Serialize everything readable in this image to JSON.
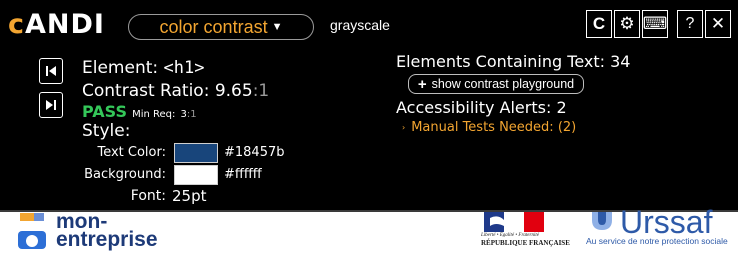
{
  "toolbar": {
    "logo_first": "c",
    "logo_rest": "ANDI",
    "module_label": "color contrast",
    "grayscale_label": "grayscale",
    "controls": [
      {
        "name": "relaunch-icon",
        "glyph": "C"
      },
      {
        "name": "gear-icon",
        "glyph": "⚙"
      },
      {
        "name": "keyboard-icon",
        "glyph": "⌨"
      },
      {
        "name": "help-icon",
        "glyph": "?"
      },
      {
        "name": "close-icon",
        "glyph": "✕"
      }
    ]
  },
  "element": {
    "label": "Element:",
    "tag": "<h1>",
    "contrast_label": "Contrast Ratio:",
    "contrast_value": "9.65",
    "contrast_suffix": ":1",
    "result": "PASS",
    "min_req_label": "Min Req:",
    "min_req_value": "3",
    "min_req_suffix": ":1",
    "style_label": "Style:",
    "text_color_label": "Text Color:",
    "text_color_value": "#18457b",
    "background_label": "Background:",
    "background_value": "#ffffff",
    "font_label": "Font:",
    "font_value": "25pt"
  },
  "summary": {
    "elements_text": "Elements Containing Text: 34",
    "playground_button": "show contrast playground",
    "alerts_heading": "Accessibility Alerts: 2",
    "manual_tests": "Manual Tests Needed: (2)"
  },
  "page": {
    "me_line1": "mon-",
    "me_line2": "entreprise",
    "rf_line1": "Liberté • Égalité • Fraternité",
    "rf_line2": "RÉPUBLIQUE FRANÇAISE",
    "urssaf_word": "Urssaf",
    "urssaf_tagline": "Au service de notre protection sociale"
  },
  "colors": {
    "andi_bg": "#000000",
    "accent_orange": "#f2a531",
    "pass_green": "#34c759",
    "text_color_swatch": "#18457b",
    "background_swatch": "#ffffff"
  }
}
